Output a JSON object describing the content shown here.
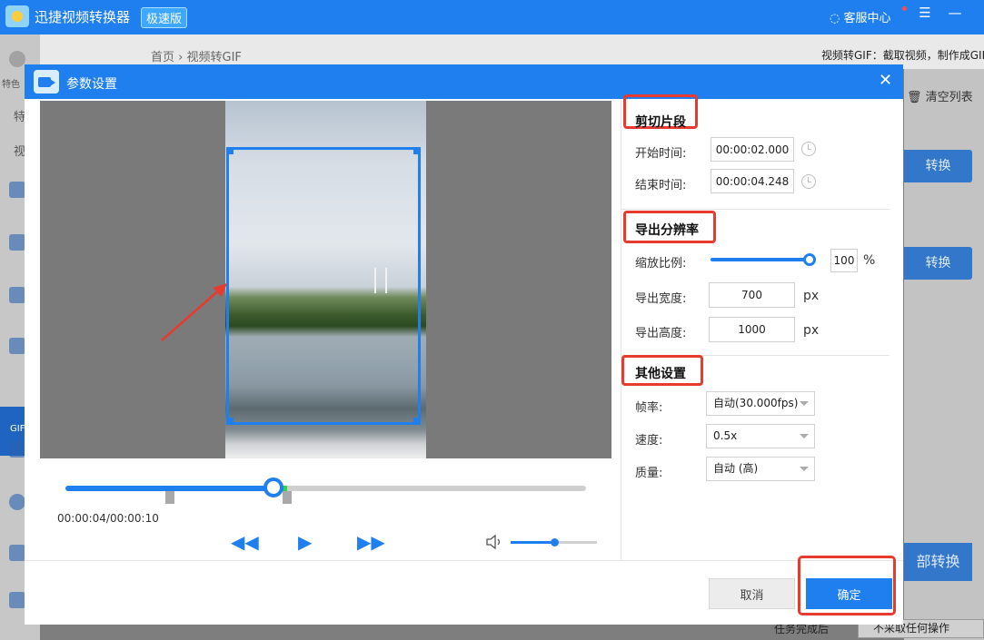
{
  "app": {
    "title": "迅捷视频转换器",
    "badge": "极速版",
    "support": "客服中心",
    "menu_icon": "menu-icon",
    "minimize_icon": "minimize-icon"
  },
  "sidebar": {
    "label_top": "特色",
    "tab_1": "特",
    "tab_2": "视",
    "active_tab_label": "GIF"
  },
  "breadcrumb": {
    "home": "首页",
    "separator": "›",
    "current": "视频转GIF"
  },
  "header_desc": "视频转GIF：截取视频，制作成GIF",
  "right_panel": {
    "clear_list": "清空列表",
    "convert_1": "转换",
    "convert_2": "转换",
    "convert_all": "部转换",
    "task_label": "任务完成后",
    "task_select": "不采取任何操作"
  },
  "dialog": {
    "title": "参数设置",
    "close_icon": "close-icon"
  },
  "player": {
    "time": "00:00:04/00:00:10",
    "rewind_icon": "rewind-icon",
    "play_icon": "play-icon",
    "forward_icon": "fast-forward-icon",
    "volume_icon": "volume-icon",
    "progress_fraction": 0.4,
    "clip_start_fraction": 0.2,
    "clip_end_fraction": 0.425,
    "volume_fraction": 0.5
  },
  "settings": {
    "clip": {
      "title": "剪切片段",
      "start_label": "开始时间:",
      "start_value": "00:00:02.000",
      "end_label": "结束时间:",
      "end_value": "00:00:04.248"
    },
    "resolution": {
      "title": "导出分辨率",
      "scale_label": "缩放比例:",
      "scale_value": "100",
      "scale_unit": "%",
      "width_label": "导出宽度:",
      "width_value": "700",
      "height_label": "导出高度:",
      "height_value": "1000",
      "px_unit": "px"
    },
    "other": {
      "title": "其他设置",
      "fps_label": "帧率:",
      "fps_value": "自动(30.000fps)",
      "speed_label": "速度:",
      "speed_value": "0.5x",
      "quality_label": "质量:",
      "quality_value": "自动 (高)"
    }
  },
  "buttons": {
    "cancel": "取消",
    "confirm": "确定"
  },
  "colors": {
    "accent": "#1f7fef",
    "highlight": "#e63b2e",
    "clip_range": "#2dd24a"
  }
}
